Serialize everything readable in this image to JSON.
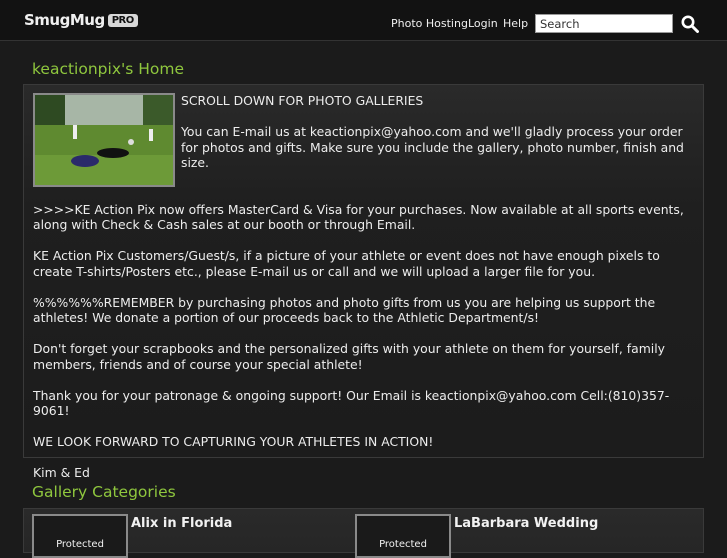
{
  "header": {
    "logo_text": "SmugMug",
    "logo_badge": "PRO",
    "nav": [
      "Photo Hosting",
      "Login",
      "Help"
    ],
    "search_placeholder": "Search",
    "search_icon": "magnifier-icon"
  },
  "home": {
    "title": "keactionpix's Home",
    "paragraphs": [
      "SCROLL DOWN FOR PHOTO GALLERIES",
      "You can E-mail us at keactionpix@yahoo.com and we'll gladly process your order for photos and gifts. Make sure you include the gallery, photo number, finish and size.",
      ">>>>KE Action Pix now offers MasterCard & Visa for your purchases. Now available at all sports events, along with Check & Cash sales at our booth or through Email.",
      "KE Action Pix Customers/Guest/s, if a picture of your athlete or event does not have enough pixels to create T-shirts/Posters etc., please E-mail us or call and we will upload a larger file for you.",
      "%%%%%%REMEMBER by purchasing photos and photo gifts from us you are helping us support the athletes! We donate a portion of our proceeds back to the Athletic Department/s!",
      "Don't forget your scrapbooks and the personalized gifts with your athlete on them for yourself, family members, friends and of course your special athlete!",
      "Thank you for your patronage & ongoing support! Our Email is keactionpix@yahoo.com Cell:(810)357-9061!",
      "WE LOOK FORWARD TO CAPTURING YOUR ATHLETES IN ACTION!",
      "Kim & Ed"
    ]
  },
  "categories": {
    "title": "Gallery Categories",
    "items": [
      {
        "name": "Alix in Florida",
        "badge": "Protected"
      },
      {
        "name": "LaBarbara Wedding",
        "badge": "Protected"
      }
    ]
  }
}
